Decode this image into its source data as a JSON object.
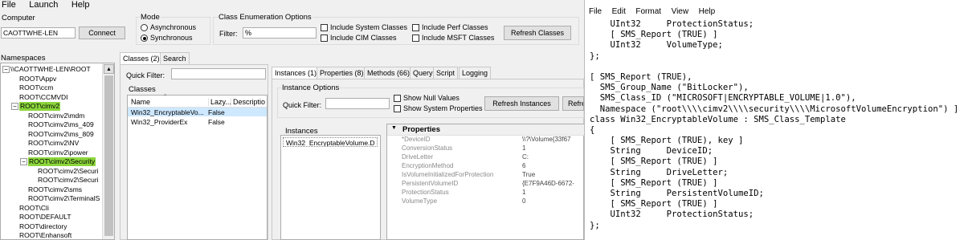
{
  "menu": [
    "File",
    "Launch",
    "Help"
  ],
  "computer": {
    "label": "Computer",
    "value": "CAOTTWHE-LEN",
    "connect": "Connect"
  },
  "mode": {
    "label": "Mode",
    "async": "Asynchronous",
    "sync": "Synchronous"
  },
  "class_enum": {
    "label": "Class Enumeration Options",
    "filter_label": "Filter:",
    "filter_value": "%",
    "include_system": "Include System Classes",
    "include_cim": "Include CIM Classes",
    "include_perf": "Include Perf Classes",
    "include_msft": "Include MSFT Classes",
    "refresh": "Refresh Classes"
  },
  "namespaces": {
    "label": "Namespaces",
    "items": [
      "\\\\CAOTTWHE-LEN\\ROOT",
      "ROOT\\Appv",
      "ROOT\\ccm",
      "ROOT\\CCMVDI",
      "ROOT\\cimv2",
      "ROOT\\cimv2\\mdm",
      "ROOT\\cimv2\\ms_409",
      "ROOT\\cimv2\\ms_809",
      "ROOT\\cimv2\\NV",
      "ROOT\\cimv2\\power",
      "ROOT\\cimv2\\Security",
      "ROOT\\cimv2\\Securi",
      "ROOT\\cimv2\\Securi",
      "ROOT\\cimv2\\sms",
      "ROOT\\cimv2\\TerminalS",
      "ROOT\\Cli",
      "ROOT\\DEFAULT",
      "ROOT\\directory",
      "ROOT\\Enhansoft"
    ]
  },
  "classes_panel": {
    "tabs": [
      "Classes (2)",
      "Search"
    ],
    "quick_filter": "Quick Filter:",
    "classes_label": "Classes",
    "columns": [
      "Name",
      "Lazy...",
      "Descriptio"
    ],
    "rows": [
      {
        "name": "Win32_EncryptableVo...",
        "lazy": "False"
      },
      {
        "name": "Win32_ProviderEx",
        "lazy": "False"
      }
    ]
  },
  "instances_panel": {
    "tabs": [
      "Instances (1)",
      "Properties (8)",
      "Methods (66)",
      "Query",
      "Script",
      "Logging"
    ],
    "options_label": "Instance Options",
    "quick_filter": "Quick Filter:",
    "show_null": "Show Null Values",
    "show_system": "Show System Properties",
    "refresh": "Refresh Instances",
    "refresh2": "Refre",
    "instances_label": "Instances",
    "instance_item": "Win32_EncryptableVolume.D",
    "properties_label": "Properties",
    "properties": [
      {
        "name": "*DeviceID",
        "value": "\\\\?\\Volume{33f67"
      },
      {
        "name": "ConversionStatus",
        "value": "1"
      },
      {
        "name": "DriveLetter",
        "value": "C:"
      },
      {
        "name": "EncryptionMethod",
        "value": "6"
      },
      {
        "name": "IsVolumeInitializedForProtection",
        "value": "True"
      },
      {
        "name": "PersistentVolumeID",
        "value": "{E7F9A46D-6672-"
      },
      {
        "name": "ProtectionStatus",
        "value": "1"
      },
      {
        "name": "VolumeType",
        "value": "0"
      }
    ]
  },
  "notepad": {
    "menu": [
      "File",
      "Edit",
      "Format",
      "View",
      "Help"
    ],
    "lines": [
      "    UInt32     ProtectionStatus;",
      "    [ SMS_Report (TRUE) ]",
      "    UInt32     VolumeType;",
      "};",
      "",
      "[ SMS_Report (TRUE),",
      "  SMS_Group_Name (\"BitLocker\"),",
      "  SMS_Class_ID (\"MICROSOFT|ENCRYPTABLE_VOLUME|1.0\"),",
      "  Namespace (\"root\\\\\\\\cimv2\\\\\\\\security\\\\\\\\MicrosoftVolumeEncryption\") ]",
      "class Win32_EncryptableVolume : SMS_Class_Template",
      "{",
      "    [ SMS_Report (TRUE), key ]",
      "    String     DeviceID;",
      "    [ SMS_Report (TRUE) ]",
      "    String     DriveLetter;",
      "    [ SMS_Report (TRUE) ]",
      "    String     PersistentVolumeID;",
      "    [ SMS_Report (TRUE) ]",
      "    UInt32     ProtectionStatus;",
      "};"
    ]
  },
  "colors": {
    "highlight": "#8cd63c",
    "selection": "#cde8ff"
  }
}
